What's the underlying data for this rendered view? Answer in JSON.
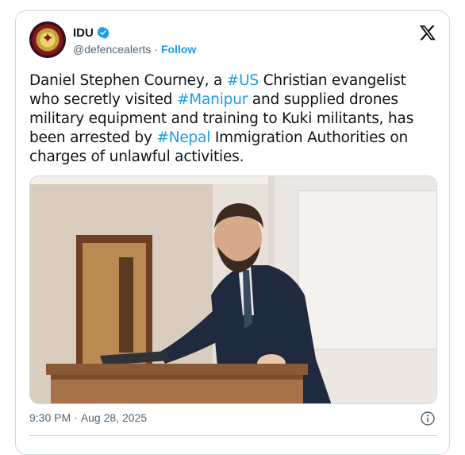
{
  "author": {
    "display_name": "IDU",
    "handle": "@defencealerts",
    "separator": "·",
    "follow_label": "Follow",
    "avatar_icon": "military-emblem-icon",
    "verified_icon": "verified-badge-icon",
    "verified_color": "#1d9bf0"
  },
  "brand": {
    "icon": "x-logo-icon"
  },
  "tweet": {
    "segments": [
      {
        "text": "Daniel Stephen Courney, a ",
        "hashtag": false
      },
      {
        "text": "#US",
        "hashtag": true
      },
      {
        "text": " Christian evangelist who secretly visited ",
        "hashtag": false
      },
      {
        "text": "#Manipur",
        "hashtag": true
      },
      {
        "text": " and supplied drones military equipment and training to Kuki militants, has been arrested by ",
        "hashtag": false
      },
      {
        "text": "#Nepal",
        "hashtag": true
      },
      {
        "text": " Immigration Authorities on charges of unlawful activities.",
        "hashtag": false
      }
    ],
    "hashtag_color": "#1d9bf0",
    "text_color": "#0f1419"
  },
  "media": {
    "description_icon": "photo-man-at-lectern"
  },
  "meta": {
    "time": "9:30 PM",
    "separator": "·",
    "date": "Aug 28, 2025",
    "info_icon": "info-icon"
  }
}
